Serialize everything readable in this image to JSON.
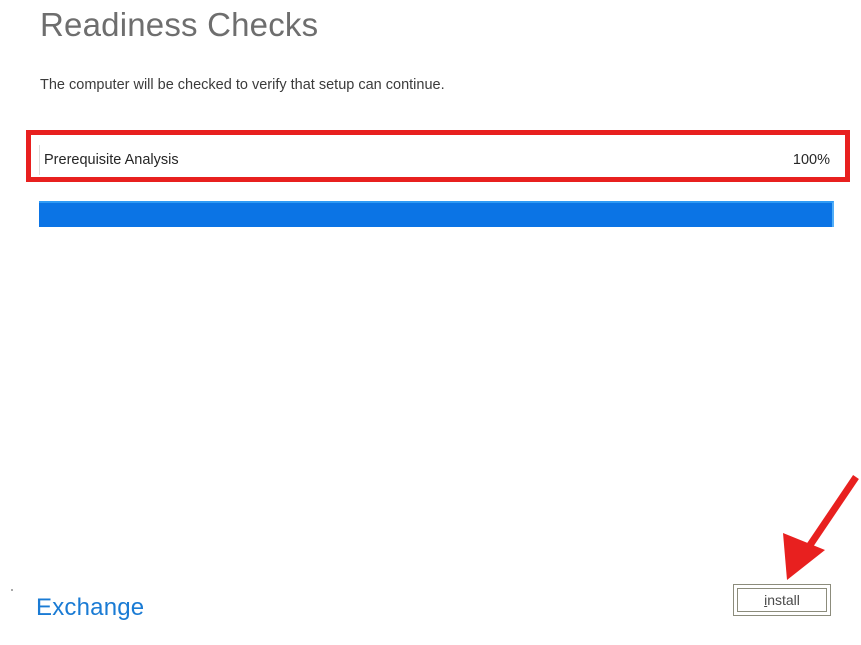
{
  "page": {
    "title": "Readiness Checks",
    "subtitle": "The computer will be checked to verify that setup can continue."
  },
  "progress": {
    "task_label": "Prerequisite Analysis",
    "percent_label": "100%",
    "percent_value": 100,
    "bar_color": "#0b74e5"
  },
  "footer": {
    "brand": "Exchange",
    "install_accel": "i",
    "install_rest": "nstall"
  },
  "annotations": {
    "highlight_color": "#e8201f",
    "arrow_color": "#e8201f"
  }
}
